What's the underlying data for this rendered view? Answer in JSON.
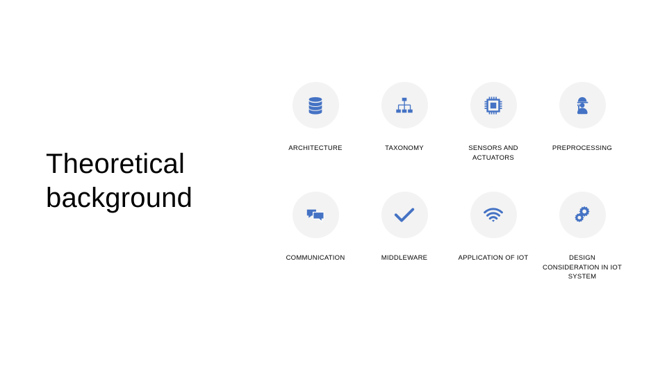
{
  "slide": {
    "title": "Theoretical\nbackground",
    "background_color": "#FFFFFF",
    "accent_color": "#4472C4",
    "circle_color": "#F3F3F3",
    "text_color": "#000000"
  },
  "grid": {
    "rows": [
      {
        "cells": [
          {
            "label": "ARCHITECTURE",
            "icon": "database-icon"
          },
          {
            "label": "TAXONOMY",
            "icon": "hierarchy-icon"
          },
          {
            "label": "SENSORS AND ACTUATORS",
            "icon": "microchip-icon"
          },
          {
            "label": "PREPROCESSING",
            "icon": "worker-icon"
          }
        ]
      },
      {
        "cells": [
          {
            "label": "COMMUNICATION",
            "icon": "chat-bubbles-icon"
          },
          {
            "label": "MIDDLEWARE",
            "icon": "checkmark-icon"
          },
          {
            "label": "APPLICATION OF IOT",
            "icon": "wifi-icon"
          },
          {
            "label": "DESIGN CONSIDERATION IN IOT SYSTEM",
            "icon": "gears-icon"
          }
        ]
      }
    ]
  }
}
